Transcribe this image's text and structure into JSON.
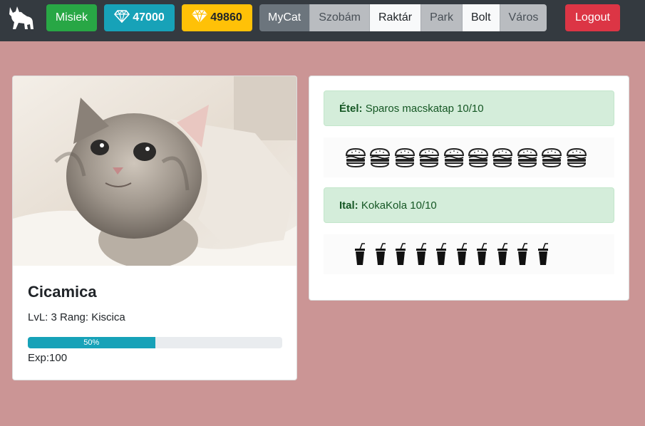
{
  "navbar": {
    "logo_icon": "cat-silhouette-icon",
    "misiek_label": "Misiek",
    "gems_blue": "47000",
    "gems_gold": "49860",
    "tabs": [
      {
        "label": "MyCat",
        "active": false
      },
      {
        "label": "Szobám",
        "active": false
      },
      {
        "label": "Raktár",
        "active": true
      },
      {
        "label": "Park",
        "active": false
      },
      {
        "label": "Bolt",
        "active": true
      },
      {
        "label": "Város",
        "active": false
      }
    ],
    "logout_label": "Logout"
  },
  "cat": {
    "name": "Cicamica",
    "stats": "LvL: 3 Rang: Kiscica",
    "progress_label": "50%",
    "progress_value": 0.5,
    "exp": "Exp:100"
  },
  "resources": {
    "food_label": "Étel:",
    "food_value": "Sparos macskatap 10/10",
    "food_count": 10,
    "food_icon": "hamburger-icon",
    "drink_label": "Ital:",
    "drink_value": "KokaKola 10/10",
    "drink_count": 10,
    "drink_icon": "soda-cup-icon"
  },
  "colors": {
    "page_bg": "#cb9595",
    "navbar_bg": "#343a40",
    "success": "#28a745",
    "info": "#17a2b8",
    "warning": "#ffc107",
    "danger": "#dc3545"
  }
}
